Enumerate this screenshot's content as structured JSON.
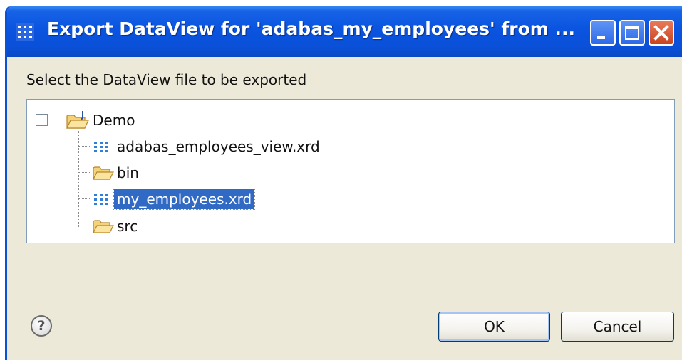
{
  "window": {
    "title": "Export DataView for 'adabas_my_employees' from ...",
    "app_icon": "dataview-grid-icon"
  },
  "title_controls": {
    "minimize_icon": "minimize-icon",
    "maximize_icon": "maximize-icon",
    "close_icon": "close-icon"
  },
  "prompt": "Select the DataView file to be exported",
  "tree": {
    "root": {
      "label": "Demo",
      "icon": "project-folder-icon",
      "expanded": true
    },
    "children": [
      {
        "label": "adabas_employees_view.xrd",
        "icon": "dataview-file-icon",
        "selected": false
      },
      {
        "label": "bin",
        "icon": "folder-icon",
        "selected": false
      },
      {
        "label": "my_employees.xrd",
        "icon": "dataview-file-icon",
        "selected": true
      },
      {
        "label": "src",
        "icon": "folder-icon",
        "selected": false
      }
    ]
  },
  "buttons": {
    "ok": "OK",
    "cancel": "Cancel"
  },
  "help": {
    "glyph": "?",
    "icon": "help-icon"
  },
  "colors": {
    "titlebar": "#0a54e0",
    "selection": "#316ac5",
    "dialog_bg": "#ece9d8",
    "close_button": "#c9441f"
  }
}
